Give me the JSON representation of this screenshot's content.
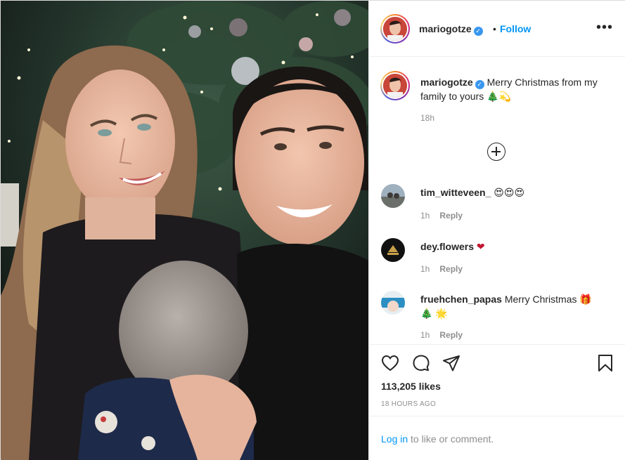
{
  "post": {
    "username": "mariogotze",
    "verified_mark": "✓",
    "dot": "•",
    "follow_label": "Follow",
    "more_label": "•••",
    "caption": "Merry Christmas from my family to yours 🎄💫",
    "caption_time": "18h"
  },
  "comments": [
    {
      "username": "tim_witteveen_",
      "text": "😍😍😍",
      "time": "1h",
      "reply_label": "Reply"
    },
    {
      "username": "dey.flowers",
      "text": "❤",
      "time": "1h",
      "reply_label": "Reply"
    },
    {
      "username": "fruehchen_papas",
      "text": "Merry Christmas 🎁 🎄 🌟",
      "time": "1h",
      "reply_label": "Reply"
    }
  ],
  "actions": {
    "likes": "113,205 likes",
    "posted_ago": "18 HOURS AGO",
    "icons": [
      "heart-icon",
      "comment-icon",
      "share-icon",
      "bookmark-icon"
    ]
  },
  "login": {
    "link_label": "Log in",
    "rest": " to like or comment."
  },
  "colors": {
    "link_blue": "#0095f6",
    "verified_blue": "#3897f0",
    "muted": "#8e8e8e",
    "heart_red": "#c0162f"
  }
}
